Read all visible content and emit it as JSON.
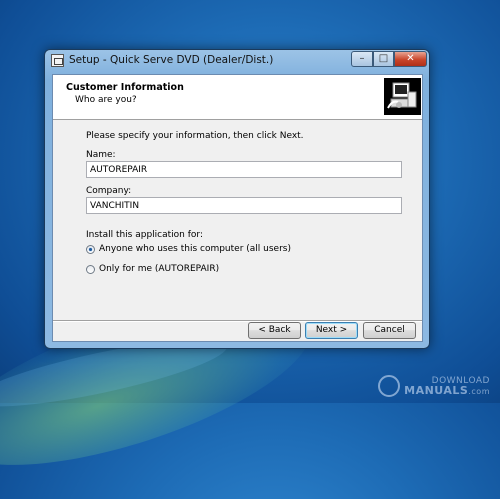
{
  "window": {
    "title": "Setup - Quick Serve DVD (Dealer/Dist.)",
    "controls": {
      "minimize": "–",
      "maximize": "□",
      "close": "✕"
    }
  },
  "header": {
    "title": "Customer Information",
    "subtitle": "Who are you?",
    "logo_icon": "installer-computer-icon"
  },
  "form": {
    "intro": "Please specify your information, then click Next.",
    "name_label": "Name:",
    "name_value": "AUTOREPAIR",
    "company_label": "Company:",
    "company_value": "VANCHITIN",
    "install_for_label": "Install this application for:",
    "options": [
      {
        "label": "Anyone who uses this computer (all users)",
        "selected": true
      },
      {
        "label": "Only for me (AUTOREPAIR)",
        "selected": false
      }
    ]
  },
  "buttons": {
    "back": "< Back",
    "next": "Next >",
    "cancel": "Cancel"
  },
  "watermark": {
    "line1": "DOWNLOAD",
    "line2": "MANUALS",
    "line3": ".com"
  },
  "colors": {
    "desktop": "#1d6bb5",
    "title_bar": "#8db9e2",
    "close_button": "#c9452a",
    "dialog_bg": "#f0f0f0"
  }
}
